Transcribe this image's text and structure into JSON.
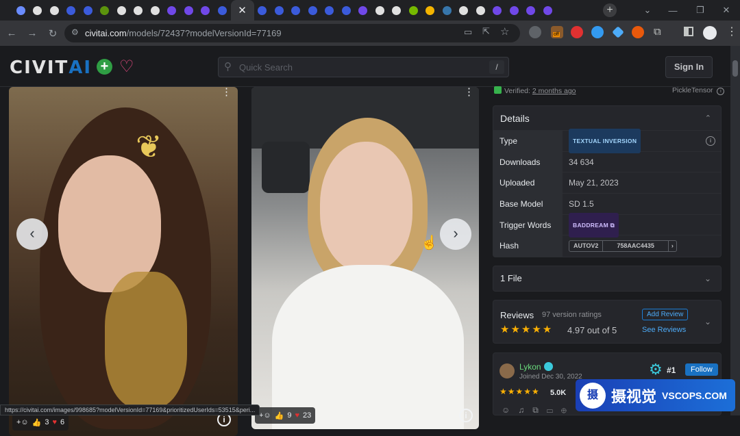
{
  "browser": {
    "close_glyph": "✕",
    "new_tab_glyph": "+",
    "url_host": "civitai.com",
    "url_path": "/models/72437?modelVersionId=77169",
    "status_url": "https://civitai.com/images/998685?modelVersionId=77169&prioritizedUserIds=53515&peri...",
    "extension_badge": "off",
    "tab_colors": [
      "#6a8cff",
      "#e0e0e0",
      "#e0e0e0",
      "#3b5bdb",
      "#3b5bdb",
      "#5c940d",
      "#e0e0e0",
      "#e0e0e0",
      "#e0e0e0",
      "#7048e8",
      "#7048e8",
      "#7048e8",
      "#3b5bdb",
      "#3b5bdb",
      "#3b5bdb",
      "#3b5bdb",
      "#3b5bdb",
      "#3b5bdb",
      "#3b5bdb",
      "#7048e8",
      "#e0e0e0",
      "#e0e0e0",
      "#76b900",
      "#f4b400",
      "#3776ab",
      "#e0e0e0",
      "#e0e0e0",
      "#7048e8",
      "#7048e8",
      "#7048e8",
      "#7048e8"
    ]
  },
  "site": {
    "logo_text": "CIVIT",
    "logo_accent": "AI",
    "search_placeholder": "Quick Search",
    "search_shortcut": "/",
    "sign_in": "Sign In"
  },
  "gallery": {
    "image1": {
      "likes": "3",
      "hearts": "6"
    },
    "image2": {
      "likes": "9",
      "hearts": "23"
    },
    "prev_glyph": "‹",
    "next_glyph": "›",
    "more_glyph": "⋮",
    "info_glyph": "i"
  },
  "sidebar": {
    "verified_label": "Verified:",
    "verified_time": "2 months ago",
    "scanner": "PickleTensor",
    "details_title": "Details",
    "rows": [
      {
        "key": "Type",
        "value": "TEXTUAL INVERSION"
      },
      {
        "key": "Downloads",
        "value": "34 634"
      },
      {
        "key": "Uploaded",
        "value": "May 21, 2023"
      },
      {
        "key": "Base Model",
        "value": "SD 1.5"
      },
      {
        "key": "Trigger Words",
        "value": "BADDREAM"
      },
      {
        "key": "Hash",
        "value": "758AAC4435"
      }
    ],
    "hash_type": "AUTOV2",
    "files_label": "1 File",
    "reviews": {
      "title": "Reviews",
      "count_label": "97 version ratings",
      "stars": "★★★★★",
      "score_label": "4.97 out of 5",
      "add_review": "Add Review",
      "see_reviews": "See Reviews"
    },
    "creator": {
      "name": "Lykon",
      "joined": "Joined Dec 30, 2022",
      "rank": "#1",
      "follow": "Follow",
      "stars": "★★★★★",
      "rating_count": "5.0K"
    }
  },
  "watermark": {
    "glyph": "摄",
    "title": "摄视觉",
    "domain": "VSCOPS.COM"
  }
}
